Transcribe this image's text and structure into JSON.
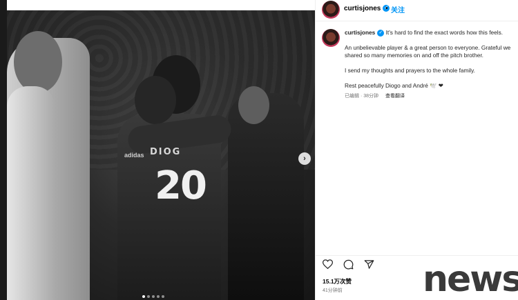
{
  "post": {
    "username": "curtisjones",
    "follow_separator": "•",
    "follow_label": "关注",
    "verified_glyph": "✓"
  },
  "photo": {
    "jersey_name": "DIOG",
    "jersey_number": "20",
    "sponsor": "adidas",
    "next_glyph": "›"
  },
  "caption": {
    "username": "curtisjones",
    "lines": [
      "It's hard to find the exact words how this feels.",
      "An unbelievable player & a great person to everyone. Grateful we shared so many memories on and off the pitch brother.",
      "I send my thoughts and prayers to the whole family.",
      "Rest peacefully Diogo and André 🕊️ ❤"
    ],
    "edited": "已编辑",
    "sep": "·",
    "age": "38分钟",
    "see_translation": "查看翻译"
  },
  "stats": {
    "likes": "15.1万次赞",
    "time": "41分钟前"
  },
  "icons": [
    "heart-icon",
    "comment-icon",
    "share-icon"
  ],
  "watermark": "news",
  "colors": {
    "accent": "#0095f6",
    "heart": "#e0245e"
  }
}
